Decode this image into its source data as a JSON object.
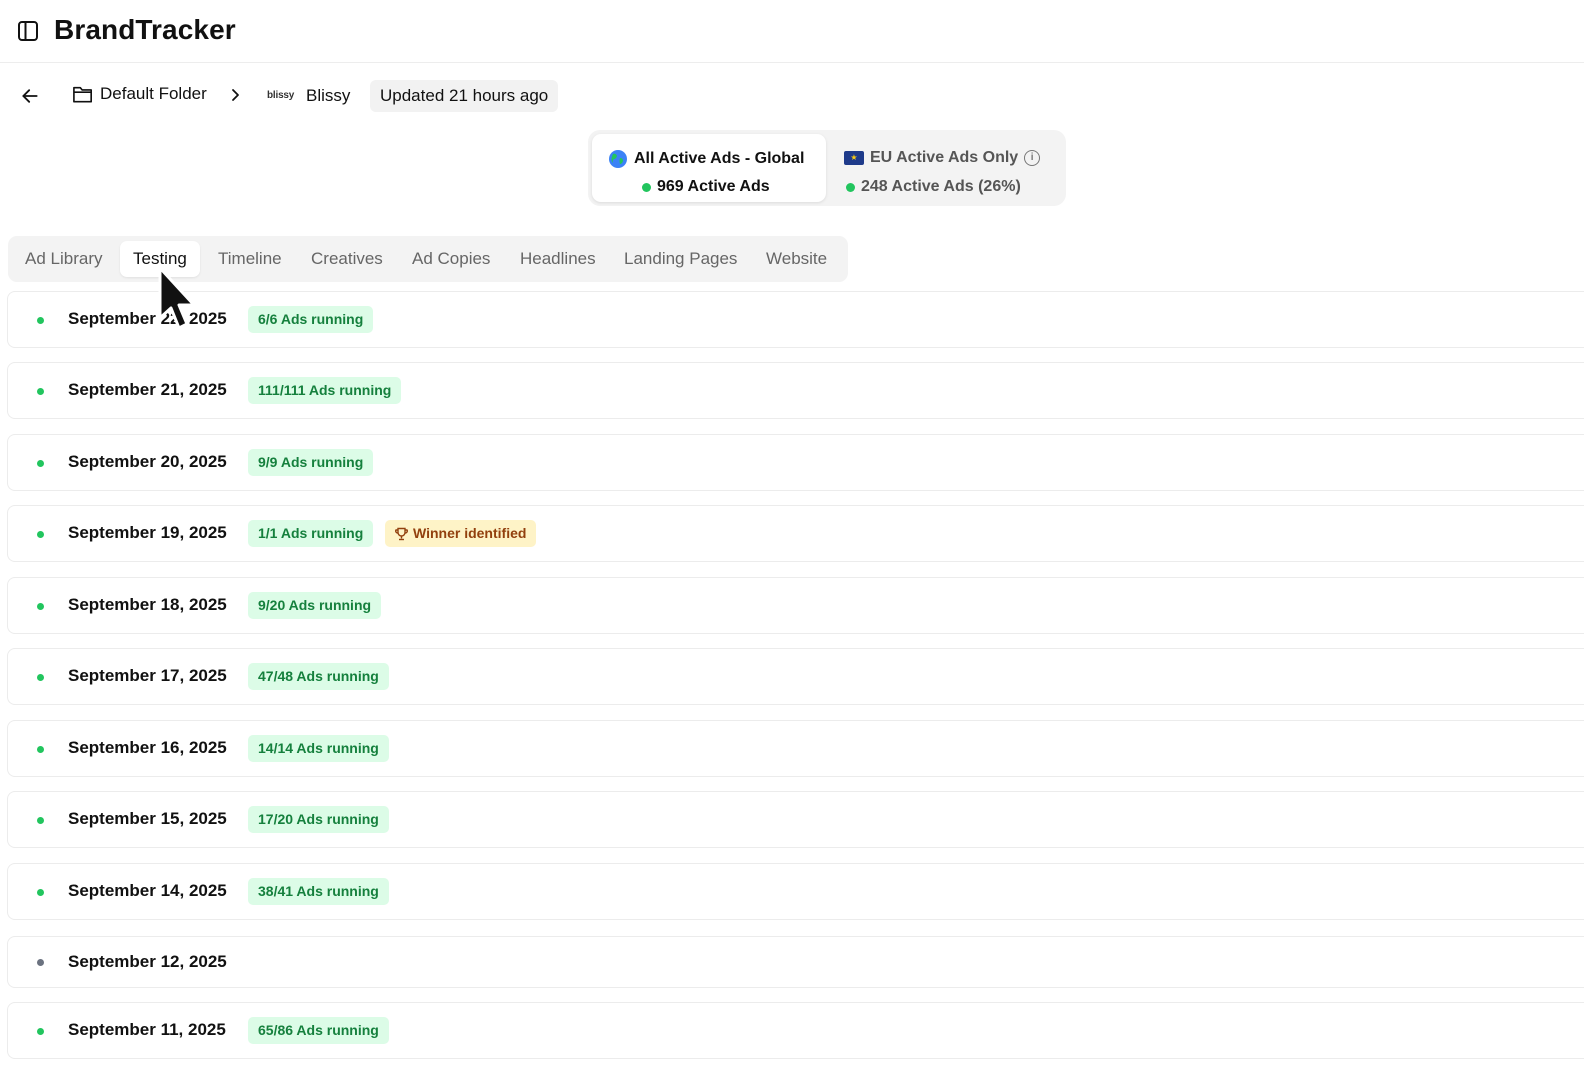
{
  "app": {
    "title": "BrandTracker",
    "sidebar_icon": "sidebar-toggle-icon"
  },
  "breadcrumb": {
    "back_icon": "arrow-left-icon",
    "folder_icon": "folder-icon",
    "folder_label": "Default Folder",
    "separator_icon": "chevron-right-icon",
    "brand_logo_text": "blissy",
    "brand_name": "Blissy",
    "updated_text": "Updated 21 hours ago"
  },
  "scope_toggle": {
    "options": [
      {
        "label": "All Active Ads - Global",
        "count": "969 Active Ads",
        "icon": "globe-icon",
        "active": true
      },
      {
        "label": "EU Active Ads Only",
        "count": "248 Active Ads (26%)",
        "icon": "eu-flag-icon",
        "active": false
      }
    ]
  },
  "tabs": [
    {
      "label": "Ad Library",
      "active": false
    },
    {
      "label": "Testing",
      "active": true
    },
    {
      "label": "Timeline",
      "active": false
    },
    {
      "label": "Creatives",
      "active": false
    },
    {
      "label": "Ad Copies",
      "active": false
    },
    {
      "label": "Headlines",
      "active": false
    },
    {
      "label": "Landing Pages",
      "active": false
    },
    {
      "label": "Website",
      "active": false
    }
  ],
  "test_rows": [
    {
      "date": "September 22, 2025",
      "ads_running": "6/6 Ads running",
      "status": "active"
    },
    {
      "date": "September 21, 2025",
      "ads_running": "111/111 Ads running",
      "status": "active"
    },
    {
      "date": "September 20, 2025",
      "ads_running": "9/9 Ads running",
      "status": "active"
    },
    {
      "date": "September 19, 2025",
      "ads_running": "1/1 Ads running",
      "status": "active",
      "winner": "Winner identified"
    },
    {
      "date": "September 18, 2025",
      "ads_running": "9/20 Ads running",
      "status": "active"
    },
    {
      "date": "September 17, 2025",
      "ads_running": "47/48 Ads running",
      "status": "active"
    },
    {
      "date": "September 16, 2025",
      "ads_running": "14/14 Ads running",
      "status": "active"
    },
    {
      "date": "September 15, 2025",
      "ads_running": "17/20 Ads running",
      "status": "active"
    },
    {
      "date": "September 14, 2025",
      "ads_running": "38/41 Ads running",
      "status": "active"
    },
    {
      "date": "September 12, 2025",
      "ads_running": "",
      "status": "inactive"
    },
    {
      "date": "September 11, 2025",
      "ads_running": "65/86 Ads running",
      "status": "active"
    }
  ],
  "colors": {
    "active_dot": "#22c55e",
    "inactive_dot": "#6b7280",
    "badge_bg": "#dcfce7",
    "badge_text": "#15803d",
    "winner_bg": "#fef3c7",
    "winner_text": "#92400e"
  }
}
